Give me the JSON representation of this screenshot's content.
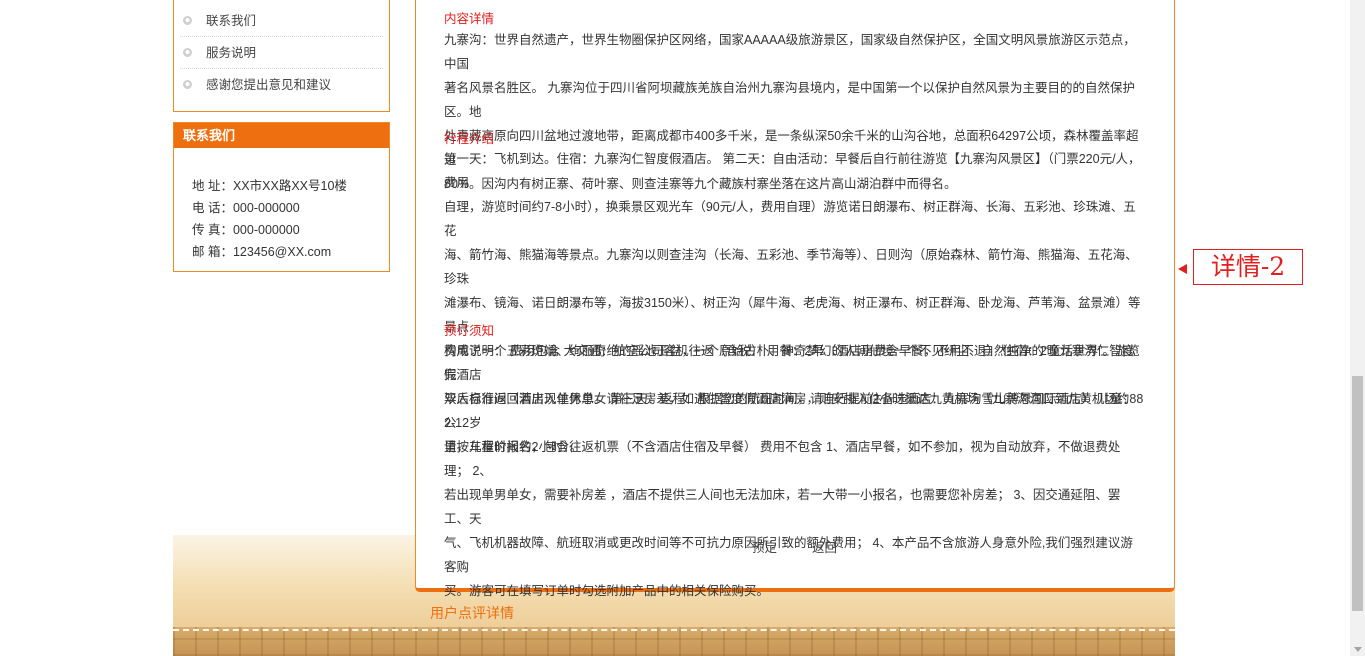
{
  "sidebar": {
    "links": [
      {
        "label": "联系我们"
      },
      {
        "label": "服务说明"
      },
      {
        "label": "感谢您提出意见和建议"
      }
    ],
    "contact": {
      "title": "联系我们",
      "address": "地 址：XX市XX路XX号10楼",
      "phone": "电 话：000-000000",
      "fax": "传 真：000-000000",
      "email": "邮 箱：123456@XX.com"
    }
  },
  "detail": {
    "content_title": "内容详情",
    "content_lines": [
      "九寨沟：世界自然遗产，世界生物圈保护区网络，国家AAAAA级旅游景区，国家级自然保护区，全国文明风景旅游区示范点，中国",
      "著名风景名胜区。 九寨沟位于四川省阿坝藏族羌族自治州九寨沟县境内，是中国第一个以保护自然风景为主要目的的自然保护区。地",
      "处青藏高原向四川盆地过渡地带，距离成都市400多千米，是一条纵深50余千米的山沟谷地，总面积64297公顷，森林覆盖率超过",
      "80%。因沟内有树正寨、荷叶寨、则查洼寨等九个藏族村寨坐落在这片高山湖泊群中而得名。"
    ],
    "itinerary_title": "行程介绍",
    "itinerary_lines": [
      "第一天：飞机到达。住宿：九寨沟仁智度假酒店。 第二天：自由活动：早餐后自行前往游览【九寨沟风景区】（门票220元/人，费用",
      "自理，游览时间约7-8小时），换乘景区观光车（90元/人，费用自理）游览诺日朗瀑布、树正群海、长海、五彩池、珍珠滩、五花",
      "海、箭竹海、熊猫海等景点。九寨沟以则查洼沟（长海、五彩池、季节海等）、日则沟（原始森林、箭竹海、熊猫海、五花海、珍珠",
      "滩瀑布、镜海、诺日朗瀑布等，海拔3150米）、树正沟（犀牛海、老虎海、树正瀑布、树正群海、卧龙海、芦苇海、盆景滩）等景点",
      "构成了一个五彩斑斓、绚丽奇绝的瑶池玉盆，一个原始古朴、神奇梦幻的人间仙境一个不见纤尘、自然纯净的“童话世界”。游览完",
      "毕后自行返回酒店入住休息。 第三天：返程：根据您的航班时间，请自行提前2小时抵达九黄机场（九寨沟沟口到九黄机场约88公",
      "里，车程时间约2小时）。"
    ],
    "booking_title": "预订须知",
    "booking_lines": [
      "费用说明： 费用包含 大交通：航空公司客机往返（含税） 用餐：2早（酒店房费含早餐，不用不退） 住宿：2晚九寨沟仁智度假酒店",
      "双人标准间（若出现单男单女请补足房差，如遇仁智度假酒店满房，则安排入住备选酒店：九寨沟雪山博恩国际酒店） 儿童：2-12岁",
      "请按儿童价报名，包含往返机票（不含酒店住宿及早餐） 费用不包含 1、酒店早餐，如不参加，视为自动放弃，不做退费处理； 2、",
      "若出现单男单女，需要补房差 ，酒店不提供三人间也无法加床，若一大带一小报名，也需要您补房差； 3、因交通延阻、罢工、天",
      "气、飞机机器故障、航班取消或更改时间等不可抗力原因所引致的额外费用； 4、本产品不含旅游人身意外险,我们强烈建议游客购",
      "买。游客可在填写订单时勾选附加产品中的相关保险购买。"
    ],
    "actions": {
      "book": "预定",
      "back": "返回"
    }
  },
  "comments": {
    "title": "用户点评详情"
  },
  "annotation": {
    "label": "详情-2"
  },
  "colors": {
    "accent": "#ee6f0f",
    "section_title": "#e01b1b",
    "annotation": "#e02020"
  }
}
